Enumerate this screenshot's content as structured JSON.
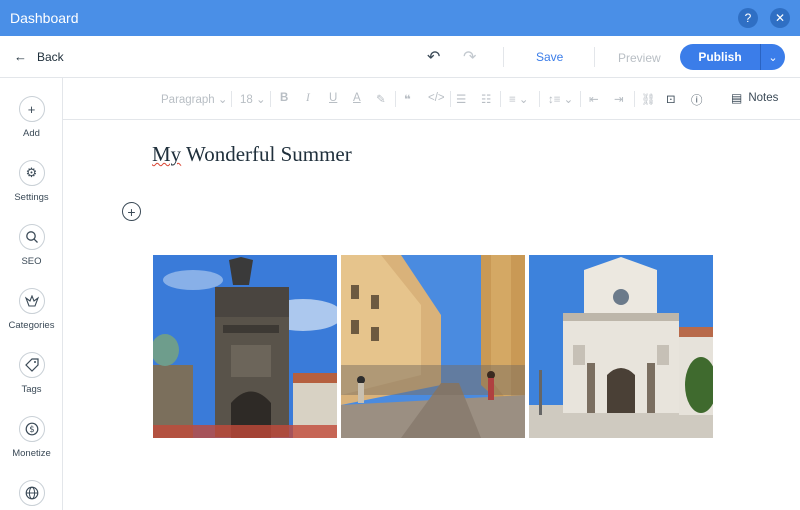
{
  "titlebar": {
    "title": "Dashboard",
    "help_icon": "?",
    "close_icon": "✕"
  },
  "actionbar": {
    "back_label": "Back",
    "save_label": "Save",
    "preview_label": "Preview",
    "publish_label": "Publish"
  },
  "sidebar": {
    "items": [
      {
        "label": "Add",
        "icon": "plus-icon",
        "glyph": "+"
      },
      {
        "label": "Settings",
        "icon": "gear-icon",
        "glyph": "⚙"
      },
      {
        "label": "SEO",
        "icon": "search-icon",
        "glyph": "⌕"
      },
      {
        "label": "Categories",
        "icon": "categories-icon",
        "glyph": "▦"
      },
      {
        "label": "Tags",
        "icon": "tag-icon",
        "glyph": "◇"
      },
      {
        "label": "Monetize",
        "icon": "dollar-icon",
        "glyph": "$"
      },
      {
        "label": "",
        "icon": "globe-icon",
        "glyph": "⊕"
      }
    ]
  },
  "toolbar": {
    "paragraph_label": "Paragraph",
    "font_size": "18",
    "notes_label": "Notes"
  },
  "post": {
    "title_part1": "My",
    "title_part2": " Wonderful Summer"
  },
  "colors": {
    "accent": "#3b7de9",
    "titlebar": "#4a8fe7"
  }
}
